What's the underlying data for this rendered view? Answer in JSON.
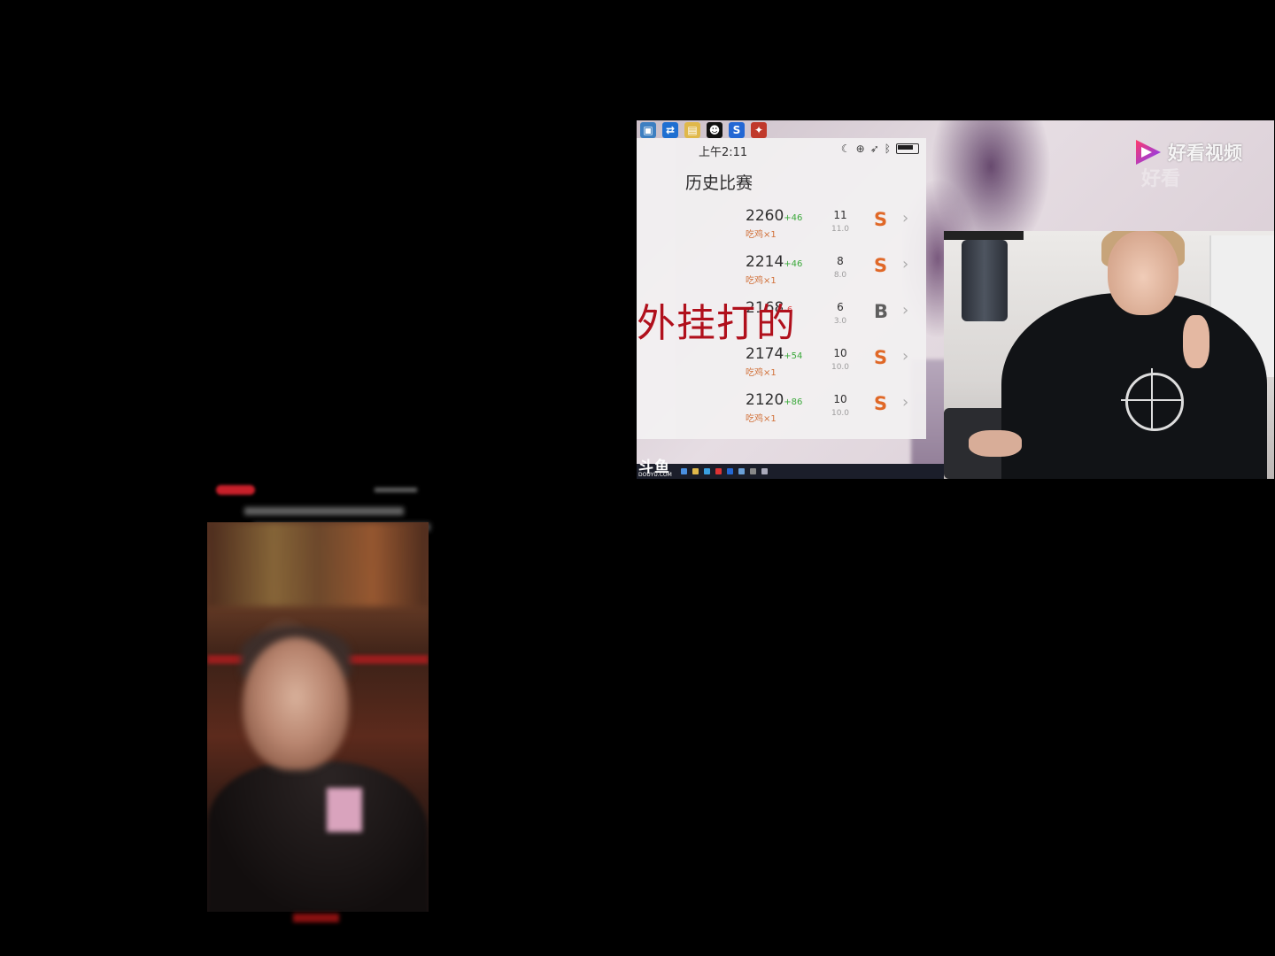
{
  "right_stream": {
    "desktop_icons": [
      {
        "icon": "computer-icon",
        "color": "#3d7fc1",
        "glyph": "▣"
      },
      {
        "icon": "teamviewer-icon",
        "color": "#1f6fd1",
        "glyph": "⇄"
      },
      {
        "icon": "folder-icon",
        "color": "#e0b84a",
        "glyph": "▤"
      },
      {
        "icon": "contact-icon",
        "color": "#111111",
        "glyph": "☻"
      },
      {
        "icon": "sogou-icon",
        "color": "#2468d4",
        "glyph": "S"
      },
      {
        "icon": "game-icon",
        "color": "#c0392b",
        "glyph": "✦"
      }
    ],
    "phone": {
      "time": "上午2:11",
      "title": "历史比赛",
      "matches": [
        {
          "score": "2260",
          "delta": "+46",
          "sub": "吃鸡×1",
          "kills": "11",
          "kd": "11.0",
          "grade": "S"
        },
        {
          "score": "2214",
          "delta": "+46",
          "sub": "吃鸡×1",
          "kills": "8",
          "kd": "8.0",
          "grade": "S"
        },
        {
          "score": "2168",
          "delta": "-6",
          "sub": "",
          "kills": "6",
          "kd": "3.0",
          "grade": "B"
        },
        {
          "score": "2174",
          "delta": "+54",
          "sub": "吃鸡×1",
          "kills": "10",
          "kd": "10.0",
          "grade": "S"
        },
        {
          "score": "2120",
          "delta": "+86",
          "sub": "吃鸡×1",
          "kills": "10",
          "kd": "10.0",
          "grade": "S"
        }
      ]
    },
    "overlay_caption": "外挂打的",
    "douyu_logo": "斗鱼",
    "douyu_sub": "DOUYU.COM",
    "watermark": "好看视频",
    "watermark_ghost": "好看",
    "colors": {
      "grade_s": "#e0601a",
      "grade_b": "#555555",
      "caption": "#b0101c",
      "delta_positive": "#2ea52e"
    }
  },
  "left_stream": {
    "colors": {
      "rec_pill": "#c8202a",
      "caption": "#8a1010"
    }
  }
}
